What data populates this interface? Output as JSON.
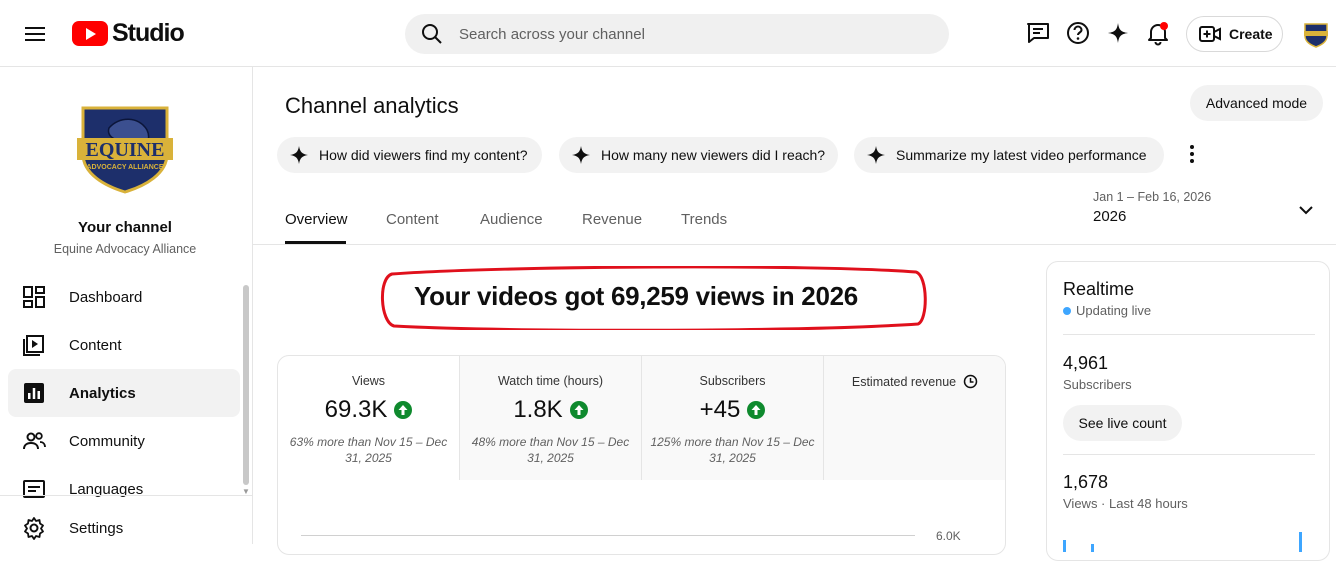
{
  "header": {
    "app_name": "Studio",
    "search_placeholder": "Search across your channel",
    "create_label": "Create"
  },
  "sidebar": {
    "your_channel": "Your channel",
    "channel_name": "Equine Advocacy Alliance",
    "logo_text": "EQUINE",
    "logo_subtext": "ADVOCACY ALLIANCE",
    "items": [
      {
        "label": "Dashboard",
        "icon": "dashboard-icon"
      },
      {
        "label": "Content",
        "icon": "content-icon"
      },
      {
        "label": "Analytics",
        "icon": "analytics-icon",
        "active": true
      },
      {
        "label": "Community",
        "icon": "community-icon"
      },
      {
        "label": "Languages",
        "icon": "languages-icon"
      },
      {
        "label": "Settings",
        "icon": "settings-icon"
      }
    ]
  },
  "main": {
    "title": "Channel analytics",
    "advanced_mode": "Advanced mode",
    "chips": [
      "How did viewers find my content?",
      "How many new viewers did I reach?",
      "Summarize my latest video performance"
    ],
    "date_range": "Jan 1 – Feb 16, 2026",
    "date_label": "2026",
    "tabs": [
      "Overview",
      "Content",
      "Audience",
      "Revenue",
      "Trends"
    ],
    "active_tab": "Overview",
    "headline": "Your videos got 69,259 views in 2026",
    "metrics": [
      {
        "label": "Views",
        "value": "69.3K",
        "comparison": "63% more than Nov 15 – Dec 31, 2025"
      },
      {
        "label": "Watch time (hours)",
        "value": "1.8K",
        "comparison": "48% more than Nov 15 – Dec 31, 2025"
      },
      {
        "label": "Subscribers",
        "value": "+45",
        "comparison": "125% more than Nov 15 – Dec 31, 2025"
      },
      {
        "label": "Estimated revenue"
      }
    ],
    "chart_tick": "6.0K"
  },
  "realtime": {
    "title": "Realtime",
    "status": "Updating live",
    "subscribers_count": "4,961",
    "subscribers_label": "Subscribers",
    "live_count_button": "See live count",
    "views_count": "1,678",
    "views_label": "Views · Last 48 hours"
  },
  "colors": {
    "brand_red": "#ff0000",
    "up_arrow_green": "#0f8a2e",
    "annotation_red": "#e0101c",
    "live_blue": "#3ea6ff"
  }
}
